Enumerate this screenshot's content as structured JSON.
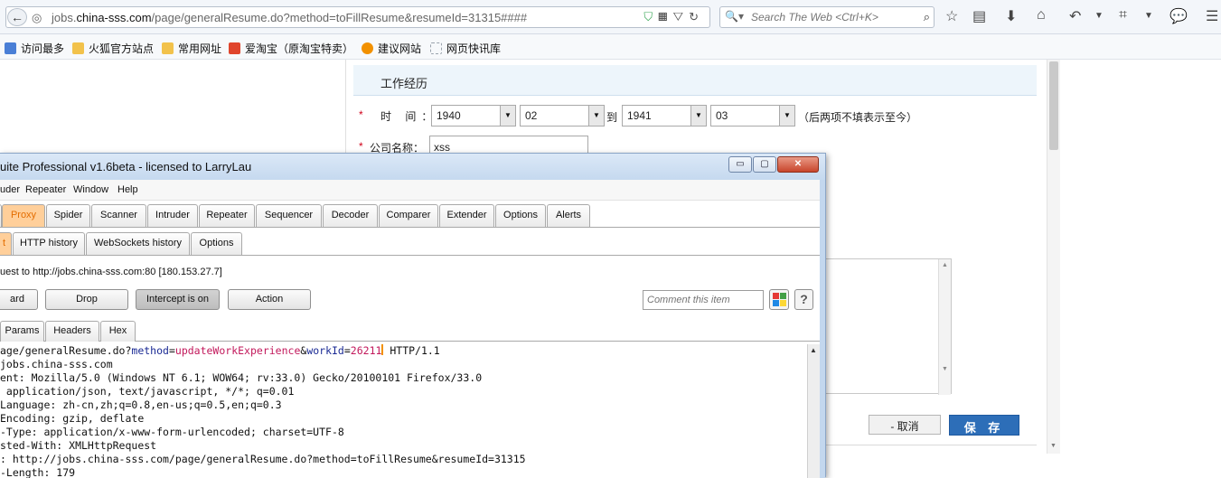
{
  "browser": {
    "back_glyph": "←",
    "url_prefix": "jobs.",
    "url_domain": "china-sss.com",
    "url_path": "/page/generalResume.do?method=toFillResume&resumeId=31315####",
    "search_placeholder": "Search The Web <Ctrl+K>",
    "bookmarks": [
      {
        "label": "访问最多",
        "icon": "most-visited-icon",
        "color": "#4a7fd6"
      },
      {
        "label": "火狐官方站点",
        "icon": "folder-icon",
        "color": "#f2c24b"
      },
      {
        "label": "常用网址",
        "icon": "folder-icon",
        "color": "#f2c24b"
      },
      {
        "label": "爱淘宝（原淘宝特卖）",
        "icon": "taobao-icon",
        "color": "#e0452c"
      },
      {
        "label": "建议网站",
        "icon": "lightbulb-icon",
        "color": "#f29100"
      },
      {
        "label": "网页快讯库",
        "icon": "webslice-icon",
        "color": "#9aa3ad"
      }
    ]
  },
  "form": {
    "section_title": "工作经历",
    "required_mark": "*",
    "time_label": "时 间：",
    "from_year": "1940",
    "from_month": "02",
    "to_label": "到",
    "to_year": "1941",
    "to_month": "03",
    "hint": "（后两项不填表示至今）",
    "company_label": "公司名称：",
    "company_value": "xss",
    "cancel_label": "- 取消",
    "save_label": "保 存"
  },
  "burp": {
    "title": "uite Professional v1.6beta - licensed to LarryLau",
    "win_buttons": [
      "▭",
      "▢",
      "✕"
    ],
    "menu": [
      "uder",
      "Repeater",
      "Window",
      "Help"
    ],
    "tabs": [
      "t",
      "Proxy",
      "Spider",
      "Scanner",
      "Intruder",
      "Repeater",
      "Sequencer",
      "Decoder",
      "Comparer",
      "Extender",
      "Options",
      "Alerts"
    ],
    "active_tab": "Proxy",
    "subtabs": [
      "t",
      "HTTP history",
      "WebSockets history",
      "Options"
    ],
    "request_info": "uest to http://jobs.china-sss.com:80  [180.153.27.7]",
    "buttons": {
      "forward": "ard",
      "drop": "Drop",
      "intercept": "Intercept is on",
      "action": "Action"
    },
    "comment_placeholder": "Comment this item",
    "help_label": "?",
    "view_tabs": [
      "",
      "Params",
      "Headers",
      "Hex"
    ],
    "request_line": {
      "prefix": "age/generalResume.do?",
      "p1_key": "method",
      "p1_val": "updateWorkExperience",
      "p2_key": "workId",
      "p2_val": "26211",
      "suffix": " HTTP/1.1"
    },
    "request_lines": [
      "jobs.china-sss.com",
      "ent: Mozilla/5.0 (Windows NT 6.1; WOW64; rv:33.0) Gecko/20100101 Firefox/33.0",
      " application/json, text/javascript, */*; q=0.01",
      "Language: zh-cn,zh;q=0.8,en-us;q=0.5,en;q=0.3",
      "Encoding: gzip, deflate",
      "-Type: application/x-www-form-urlencoded; charset=UTF-8",
      "sted-With: XMLHttpRequest",
      ": http://jobs.china-sss.com/page/generalResume.do?method=toFillResume&resumeId=31315",
      "-Length: 179"
    ]
  }
}
